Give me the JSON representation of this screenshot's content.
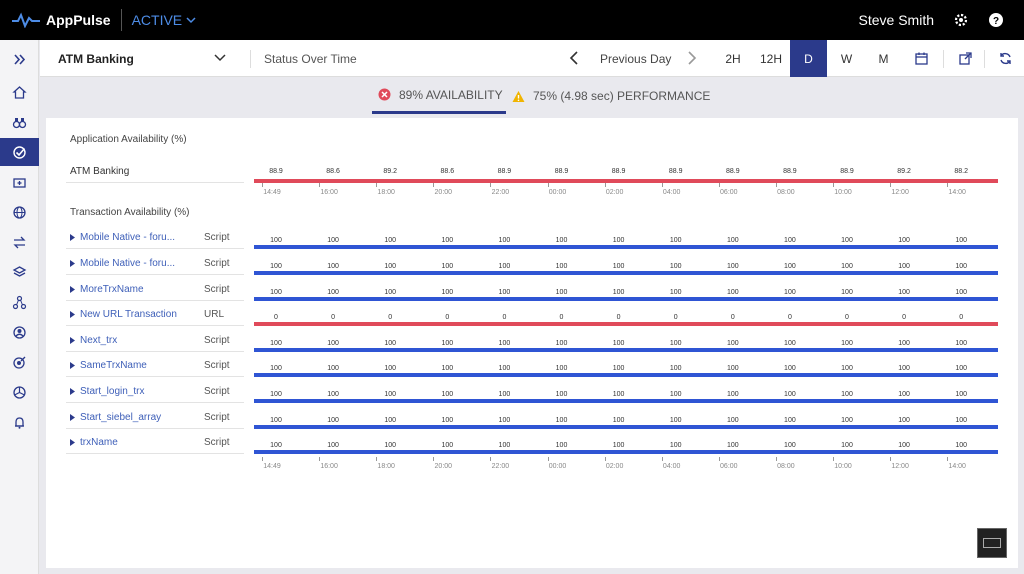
{
  "topbar": {
    "app_name": "AppPulse",
    "environment": "ACTIVE",
    "user_name": "Steve Smith"
  },
  "subheader": {
    "application": "ATM Banking",
    "view_title": "Status Over Time",
    "prev_label": "Previous Day",
    "ranges": [
      "2H",
      "12H",
      "D",
      "W",
      "M"
    ],
    "active_range": "D"
  },
  "tabs": {
    "availability": "89% AVAILABILITY",
    "performance": "75% (4.98 sec) PERFORMANCE"
  },
  "colors": {
    "accent": "#2b3a8b",
    "good": "#2f55d4",
    "bad": "#e04a5a",
    "warn": "#f0b400"
  },
  "app_availability": {
    "title": "Application Availability (%)",
    "row_name": "ATM Banking",
    "values": [
      "88.9",
      "88.6",
      "89.2",
      "88.6",
      "88.9",
      "88.9",
      "88.9",
      "88.9",
      "88.9",
      "88.9",
      "88.9",
      "89.2",
      "88.2"
    ]
  },
  "time_ticks": [
    "14:49",
    "16:00",
    "18:00",
    "20:00",
    "22:00",
    "00:00",
    "02:00",
    "04:00",
    "06:00",
    "08:00",
    "10:00",
    "12:00",
    "14:00"
  ],
  "transactions": {
    "title": "Transaction Availability (%)",
    "rows": [
      {
        "name": "Mobile Native - foru...",
        "type": "Script",
        "status": "good",
        "values": [
          "100",
          "100",
          "100",
          "100",
          "100",
          "100",
          "100",
          "100",
          "100",
          "100",
          "100",
          "100",
          "100"
        ]
      },
      {
        "name": "Mobile Native - foru...",
        "type": "Script",
        "status": "good",
        "values": [
          "100",
          "100",
          "100",
          "100",
          "100",
          "100",
          "100",
          "100",
          "100",
          "100",
          "100",
          "100",
          "100"
        ]
      },
      {
        "name": "MoreTrxName",
        "type": "Script",
        "status": "good",
        "values": [
          "100",
          "100",
          "100",
          "100",
          "100",
          "100",
          "100",
          "100",
          "100",
          "100",
          "100",
          "100",
          "100"
        ]
      },
      {
        "name": "New URL Transaction",
        "type": "URL",
        "status": "bad",
        "values": [
          "0",
          "0",
          "0",
          "0",
          "0",
          "0",
          "0",
          "0",
          "0",
          "0",
          "0",
          "0",
          "0"
        ]
      },
      {
        "name": "Next_trx",
        "type": "Script",
        "status": "good",
        "values": [
          "100",
          "100",
          "100",
          "100",
          "100",
          "100",
          "100",
          "100",
          "100",
          "100",
          "100",
          "100",
          "100"
        ]
      },
      {
        "name": "SameTrxName",
        "type": "Script",
        "status": "good",
        "values": [
          "100",
          "100",
          "100",
          "100",
          "100",
          "100",
          "100",
          "100",
          "100",
          "100",
          "100",
          "100",
          "100"
        ]
      },
      {
        "name": "Start_login_trx",
        "type": "Script",
        "status": "good",
        "values": [
          "100",
          "100",
          "100",
          "100",
          "100",
          "100",
          "100",
          "100",
          "100",
          "100",
          "100",
          "100",
          "100"
        ]
      },
      {
        "name": "Start_siebel_array",
        "type": "Script",
        "status": "good",
        "values": [
          "100",
          "100",
          "100",
          "100",
          "100",
          "100",
          "100",
          "100",
          "100",
          "100",
          "100",
          "100",
          "100"
        ]
      },
      {
        "name": "trxName",
        "type": "Script",
        "status": "good",
        "values": [
          "100",
          "100",
          "100",
          "100",
          "100",
          "100",
          "100",
          "100",
          "100",
          "100",
          "100",
          "100",
          "100"
        ]
      }
    ]
  }
}
